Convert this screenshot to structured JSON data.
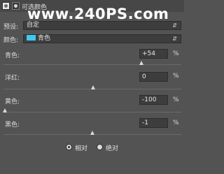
{
  "panel": {
    "title": "可选颜色",
    "watermark": "www.240PS.com"
  },
  "preset": {
    "label": "预设:",
    "value": "自定"
  },
  "colors": {
    "label": "颜色:",
    "value": "青色",
    "swatch": "#3ecaf0"
  },
  "sliders": {
    "cyan": {
      "label": "青色:",
      "value": "+54",
      "unit": "%",
      "level": 0.54
    },
    "magenta": {
      "label": "洋红:",
      "value": "0",
      "unit": "%",
      "level": 0
    },
    "yellow": {
      "label": "黄色:",
      "value": "-100",
      "unit": "%",
      "level": -1
    },
    "black": {
      "label": "黑色:",
      "value": "-1",
      "unit": "%",
      "level": -0.01
    }
  },
  "method": {
    "relative": "相对",
    "absolute": "绝对",
    "selected": "relative"
  }
}
